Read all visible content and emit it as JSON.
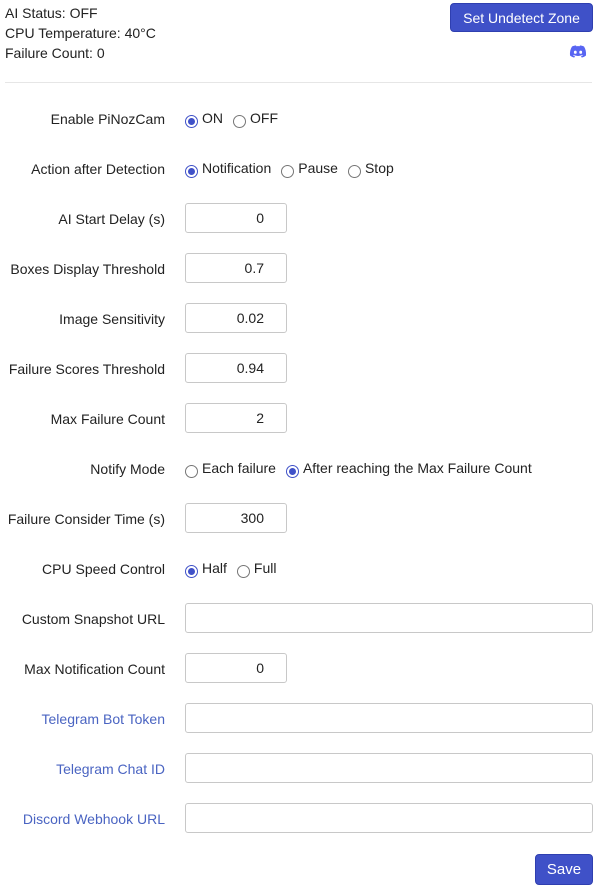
{
  "status": {
    "ai_status": "AI Status: OFF",
    "cpu_temperature": "CPU Temperature: 40°C",
    "failure_count": "Failure Count: 0"
  },
  "header": {
    "undetect_button": "Set Undetect Zone",
    "discord_icon": "discord-icon"
  },
  "colors": {
    "accent": "#3f51c8",
    "link": "#4a64c2"
  },
  "form": {
    "enable": {
      "label": "Enable PiNozCam",
      "options": [
        "ON",
        "OFF"
      ],
      "selected": "ON"
    },
    "action": {
      "label": "Action after Detection",
      "options": [
        "Notification",
        "Pause",
        "Stop"
      ],
      "selected": "Notification"
    },
    "ai_start_delay": {
      "label": "AI Start Delay (s)",
      "value": "0"
    },
    "boxes_threshold": {
      "label": "Boxes Display Threshold",
      "value": "0.7"
    },
    "image_sensitivity": {
      "label": "Image Sensitivity",
      "value": "0.02"
    },
    "failure_scores_threshold": {
      "label": "Failure Scores Threshold",
      "value": "0.94"
    },
    "max_failure_count": {
      "label": "Max Failure Count",
      "value": "2"
    },
    "notify_mode": {
      "label": "Notify Mode",
      "options": [
        "Each failure",
        "After reaching the Max Failure Count"
      ],
      "selected": "After reaching the Max Failure Count"
    },
    "failure_consider_time": {
      "label": "Failure Consider Time (s)",
      "value": "300"
    },
    "cpu_speed": {
      "label": "CPU Speed Control",
      "options": [
        "Half",
        "Full"
      ],
      "selected": "Half"
    },
    "custom_snapshot_url": {
      "label": "Custom Snapshot URL",
      "value": ""
    },
    "max_notification_count": {
      "label": "Max Notification Count",
      "value": "0"
    },
    "telegram_bot_token": {
      "label": "Telegram Bot Token",
      "value": ""
    },
    "telegram_chat_id": {
      "label": "Telegram Chat ID",
      "value": ""
    },
    "discord_webhook_url": {
      "label": "Discord Webhook URL",
      "value": ""
    }
  },
  "footer": {
    "save_button": "Save"
  }
}
